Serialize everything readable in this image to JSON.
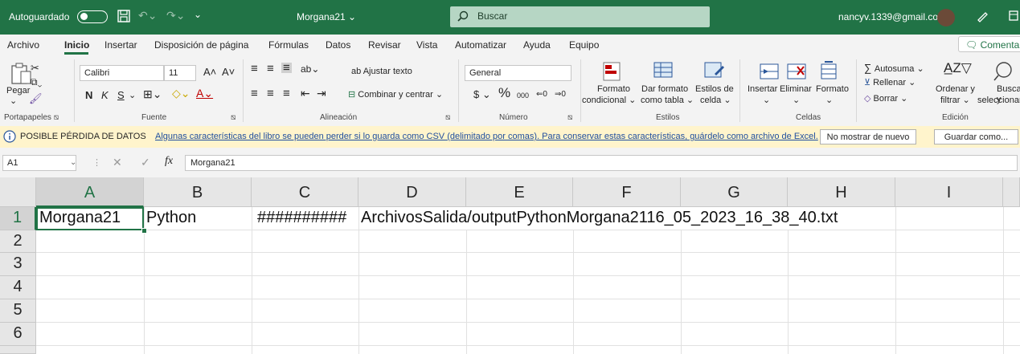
{
  "titlebar": {
    "autosave": "Autoguardado",
    "filename": "Morgana21",
    "search": "Buscar",
    "user": "nancyv.1339@gmail.com"
  },
  "menu": {
    "items": [
      "Archivo",
      "Inicio",
      "Insertar",
      "Disposición de página",
      "Fórmulas",
      "Datos",
      "Revisar",
      "Vista",
      "Automatizar",
      "Ayuda",
      "Equipo"
    ],
    "comment": "Comenta"
  },
  "ribbon": {
    "clipboard": {
      "paste": "Pegar",
      "group": "Portapapeles"
    },
    "font": {
      "name": "Calibri",
      "size": "11",
      "bold": "N",
      "italic": "K",
      "underline": "S",
      "group": "Fuente"
    },
    "alignment": {
      "wrap": "Ajustar texto",
      "merge": "Combinar y centrar",
      "group": "Alineación"
    },
    "number": {
      "format": "General",
      "group": "Número"
    },
    "styles": {
      "cond1": "Formato",
      "cond2": "condicional",
      "table1": "Dar formato",
      "table2": "como tabla",
      "cell1": "Estilos de",
      "cell2": "celda",
      "group": "Estilos"
    },
    "cells": {
      "insert": "Insertar",
      "delete": "Eliminar",
      "format": "Formato",
      "group": "Celdas"
    },
    "editing": {
      "autosum": "Autosuma",
      "fill": "Rellenar",
      "clear": "Borrar",
      "sort1": "Ordenar y",
      "sort2": "filtrar",
      "find1": "Buscar y",
      "find2": "seleccionar",
      "group": "Edición"
    }
  },
  "infobar": {
    "title": "POSIBLE PÉRDIDA DE DATOS",
    "message": "Algunas características del libro se pueden perder si lo guarda como CSV (delimitado por comas). Para conservar estas características, guárdelo como archivo de Excel.",
    "dontshow": "No mostrar de nuevo",
    "saveas": "Guardar como..."
  },
  "formula": {
    "namebox": "A1",
    "fx": "fx",
    "content": "Morgana21"
  },
  "grid": {
    "columns": [
      "A",
      "B",
      "C",
      "D",
      "E",
      "F",
      "G",
      "H",
      "I"
    ],
    "rows": [
      "1",
      "2",
      "3",
      "4",
      "5",
      "6"
    ],
    "cells": {
      "A1": "Morgana21",
      "B1": "Python",
      "C1": "##########",
      "D1": "ArchivosSalida/outputPythonMorgana2116_05_2023_16_38_40.txt"
    }
  },
  "colors": {
    "brand": "#217346",
    "infobar": "#fff4cc"
  }
}
